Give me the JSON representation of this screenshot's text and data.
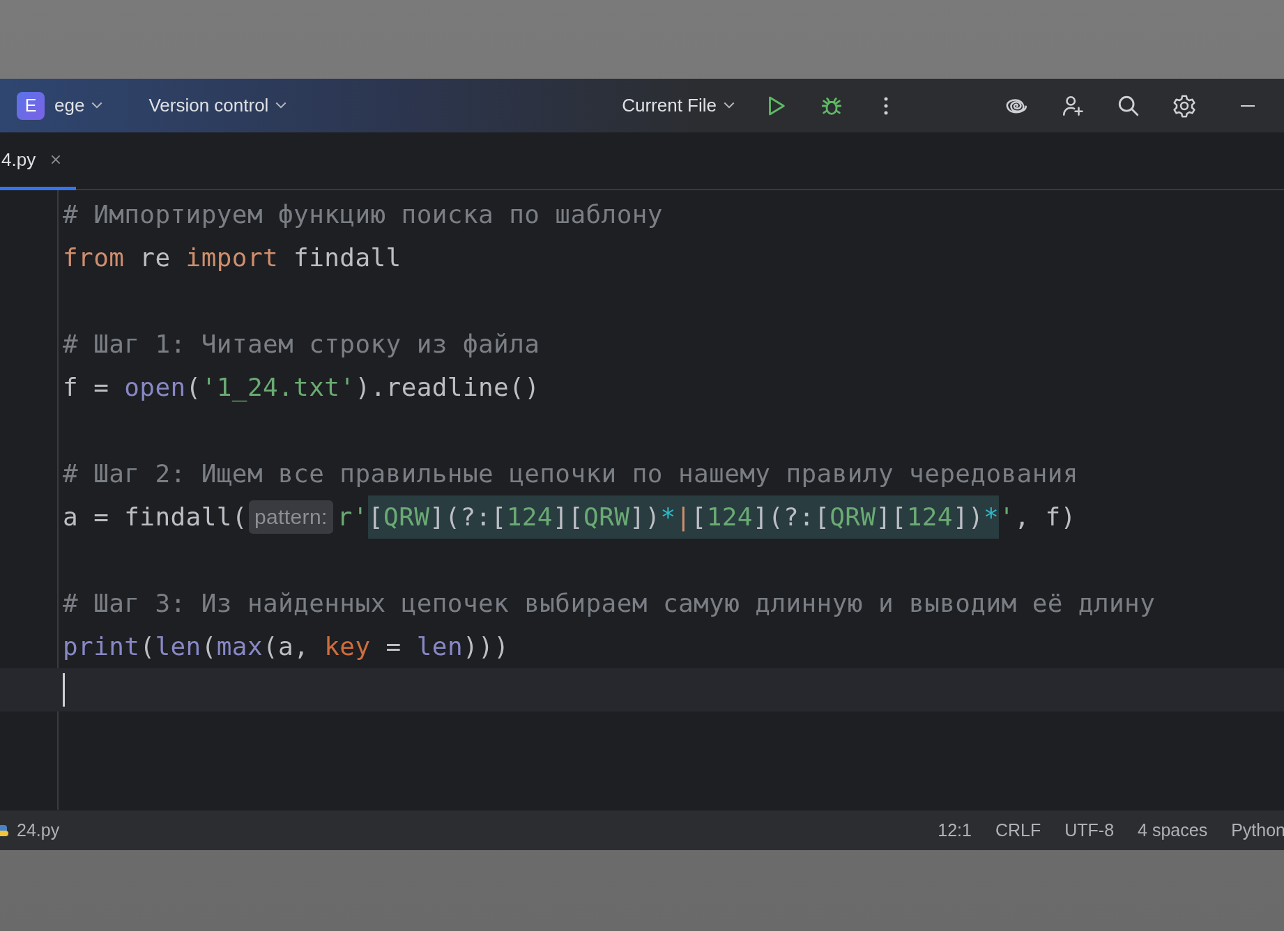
{
  "toolbar": {
    "project_badge": "E",
    "project": "ege",
    "vcs": "Version control",
    "run_config": "Current File"
  },
  "tabs": [
    {
      "label": "4.py",
      "selected": true
    }
  ],
  "editor": {
    "lines": [
      {
        "current": false,
        "tokens": [
          {
            "text": "# Импортируем функцию поиска по шаблону",
            "kind": "comment"
          }
        ]
      },
      {
        "current": false,
        "tokens": [
          {
            "text": "from",
            "kind": "keyword"
          },
          {
            "text": " re ",
            "kind": "plain"
          },
          {
            "text": "import",
            "kind": "keyword"
          },
          {
            "text": " findall",
            "kind": "plain"
          }
        ]
      },
      {
        "current": false
      },
      {
        "current": false,
        "tokens": [
          {
            "text": "# Шаг 1: Читаем строку из файла",
            "kind": "comment"
          }
        ]
      },
      {
        "current": false,
        "tokens": [
          {
            "text": "f = ",
            "kind": "plain"
          },
          {
            "text": "open",
            "kind": "builtin"
          },
          {
            "text": "(",
            "kind": "plain"
          },
          {
            "text": "'1_24.txt'",
            "kind": "string"
          },
          {
            "text": ").readline()",
            "kind": "plain"
          }
        ]
      },
      {
        "current": false
      },
      {
        "current": false,
        "tokens": [
          {
            "text": "# Шаг 2: Ищем все правильные цепочки по нашему правилу чередования",
            "kind": "comment"
          }
        ]
      },
      {
        "current": false,
        "tokens": [
          {
            "text": "a = findall(",
            "kind": "plain"
          },
          {
            "text": "pattern:",
            "kind": "hint"
          },
          {
            "text": "r'",
            "kind": "string"
          },
          {
            "text": "[",
            "kind": "plain",
            "highlighted": true
          },
          {
            "text": "QRW",
            "kind": "string",
            "highlighted": true
          },
          {
            "text": "](?:[",
            "kind": "plain",
            "highlighted": true
          },
          {
            "text": "124",
            "kind": "string",
            "highlighted": true
          },
          {
            "text": "][",
            "kind": "plain",
            "highlighted": true
          },
          {
            "text": "QRW",
            "kind": "string",
            "highlighted": true
          },
          {
            "text": "])",
            "kind": "plain",
            "highlighted": true
          },
          {
            "text": "*",
            "kind": "operator",
            "highlighted": true
          },
          {
            "text": "|",
            "kind": "keyword",
            "highlighted": true
          },
          {
            "text": "[",
            "kind": "plain",
            "highlighted": true
          },
          {
            "text": "124",
            "kind": "string",
            "highlighted": true
          },
          {
            "text": "](?:[",
            "kind": "plain",
            "highlighted": true
          },
          {
            "text": "QRW",
            "kind": "string",
            "highlighted": true
          },
          {
            "text": "][",
            "kind": "plain",
            "highlighted": true
          },
          {
            "text": "124",
            "kind": "string",
            "highlighted": true
          },
          {
            "text": "])",
            "kind": "plain",
            "highlighted": true
          },
          {
            "text": "*",
            "kind": "operator",
            "highlighted": true
          },
          {
            "text": "'",
            "kind": "string"
          },
          {
            "text": ", f)",
            "kind": "plain"
          }
        ]
      },
      {
        "current": false
      },
      {
        "current": false,
        "tokens": [
          {
            "text": "# Шаг 3: Из найденных цепочек выбираем самую длинную и выводим её длину",
            "kind": "comment"
          }
        ]
      },
      {
        "current": false,
        "tokens": [
          {
            "text": "print",
            "kind": "builtin"
          },
          {
            "text": "(",
            "kind": "plain"
          },
          {
            "text": "len",
            "kind": "builtin"
          },
          {
            "text": "(",
            "kind": "plain"
          },
          {
            "text": "max",
            "kind": "builtin"
          },
          {
            "text": "(a, ",
            "kind": "plain"
          },
          {
            "text": "key",
            "kind": "param"
          },
          {
            "text": " = ",
            "kind": "plain"
          },
          {
            "text": "len",
            "kind": "builtin"
          },
          {
            "text": ")))",
            "kind": "plain"
          }
        ]
      },
      {
        "current": true
      }
    ]
  },
  "status_bar": {
    "file": "24.py",
    "items": [
      "12:1",
      "CRLF",
      "UTF-8",
      "4 spaces",
      "Python"
    ]
  }
}
